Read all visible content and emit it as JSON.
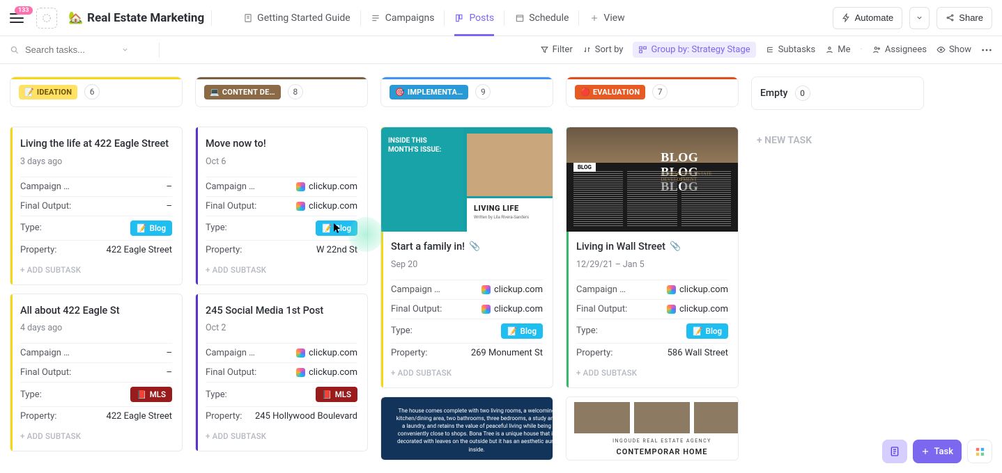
{
  "header": {
    "notif_count": "133",
    "space_icon": "🏡",
    "space_title": "Real Estate Marketing",
    "tabs": [
      {
        "label": "Getting Started Guide"
      },
      {
        "label": "Campaigns"
      },
      {
        "label": "Posts",
        "active": true
      },
      {
        "label": "Schedule"
      },
      {
        "label": "View",
        "plus": true
      }
    ],
    "automate": "Automate",
    "share": "Share"
  },
  "toolbar": {
    "search_placeholder": "Search tasks...",
    "filter": "Filter",
    "sort": "Sort by",
    "group": "Group by: Strategy Stage",
    "subtasks": "Subtasks",
    "me": "Me",
    "assignees": "Assignees",
    "show": "Show"
  },
  "columns": {
    "ideation": {
      "label": "IDEATION",
      "emoji": "📝",
      "count": "6"
    },
    "content": {
      "label": "CONTENT DE…",
      "emoji": "💻",
      "count": "8"
    },
    "impl": {
      "label": "IMPLEMENTA…",
      "emoji": "🎯",
      "count": "9"
    },
    "eval": {
      "label": "EVALUATION",
      "emoji": "🔴",
      "count": "7"
    },
    "empty": {
      "label": "Empty",
      "count": "0"
    },
    "new_task": "+ NEW TASK"
  },
  "labels": {
    "campaign": "Campaign …",
    "output": "Final Output:",
    "type": "Type:",
    "property": "Property:",
    "add_sub": "+ ADD SUBTASK",
    "blog": "Blog",
    "mls": "MLS",
    "dash": "–"
  },
  "cards": {
    "c1": {
      "title": "Living the life at 422 Eagle Street",
      "meta": "3 days ago",
      "campaign": "–",
      "output": "–",
      "type": "blog",
      "property": "422 Eagle Street"
    },
    "c2": {
      "title": "All about 422 Eagle St",
      "meta": "4 days ago",
      "campaign": "–",
      "output": "–",
      "type": "mls",
      "property": "422 Eagle Street"
    },
    "c3": {
      "title": "Move now to!",
      "meta": "Oct 6",
      "campaign": "clickup.com",
      "output": "clickup.com",
      "type": "blog",
      "property": "W 22nd St"
    },
    "c4": {
      "title": "245 Social Media 1st Post",
      "meta": "Oct 2",
      "campaign": "clickup.com",
      "output": "clickup.com",
      "type": "mls",
      "property": "245 Hollywood Boulevard"
    },
    "c5": {
      "title": "Start a family in!",
      "meta": "Sep 20",
      "campaign": "clickup.com",
      "output": "clickup.com",
      "type": "blog",
      "property": "269 Monument St"
    },
    "c6": {
      "title": "Living in Wall Street",
      "meta": "12/29/21  –  Jan 5",
      "campaign": "clickup.com",
      "output": "clickup.com",
      "type": "blog",
      "property": "586 Wall Street"
    }
  },
  "thumbs": {
    "teal_inside": "INSIDE THIS MONTH'S ISSUE:",
    "teal_living": "LIVING LIFE",
    "teal_byline": "Written by Lila Rivera-Sanders",
    "blog_label": "BLOG",
    "blog_banner": "BLOG BLOG BLOG",
    "blog_sub": "LICERIA REAL ESTATE DEVELOPMENT",
    "navy": "The house comes complete with two living rooms, a welcoming kitchen/dining area, two bathrooms, three bedrooms, a study and a laundry, and retains the value of peaceful living while being conveniently close to shops. Bona Tree is a unique house that is decorated with leaves on the outside but it has an aesthetic aura inside.",
    "gallery_sub": "INGOUDE REAL ESTATE AGENCY",
    "gallery_title": "CONTEMPORAR HOME"
  },
  "floating": {
    "task": "Task"
  }
}
